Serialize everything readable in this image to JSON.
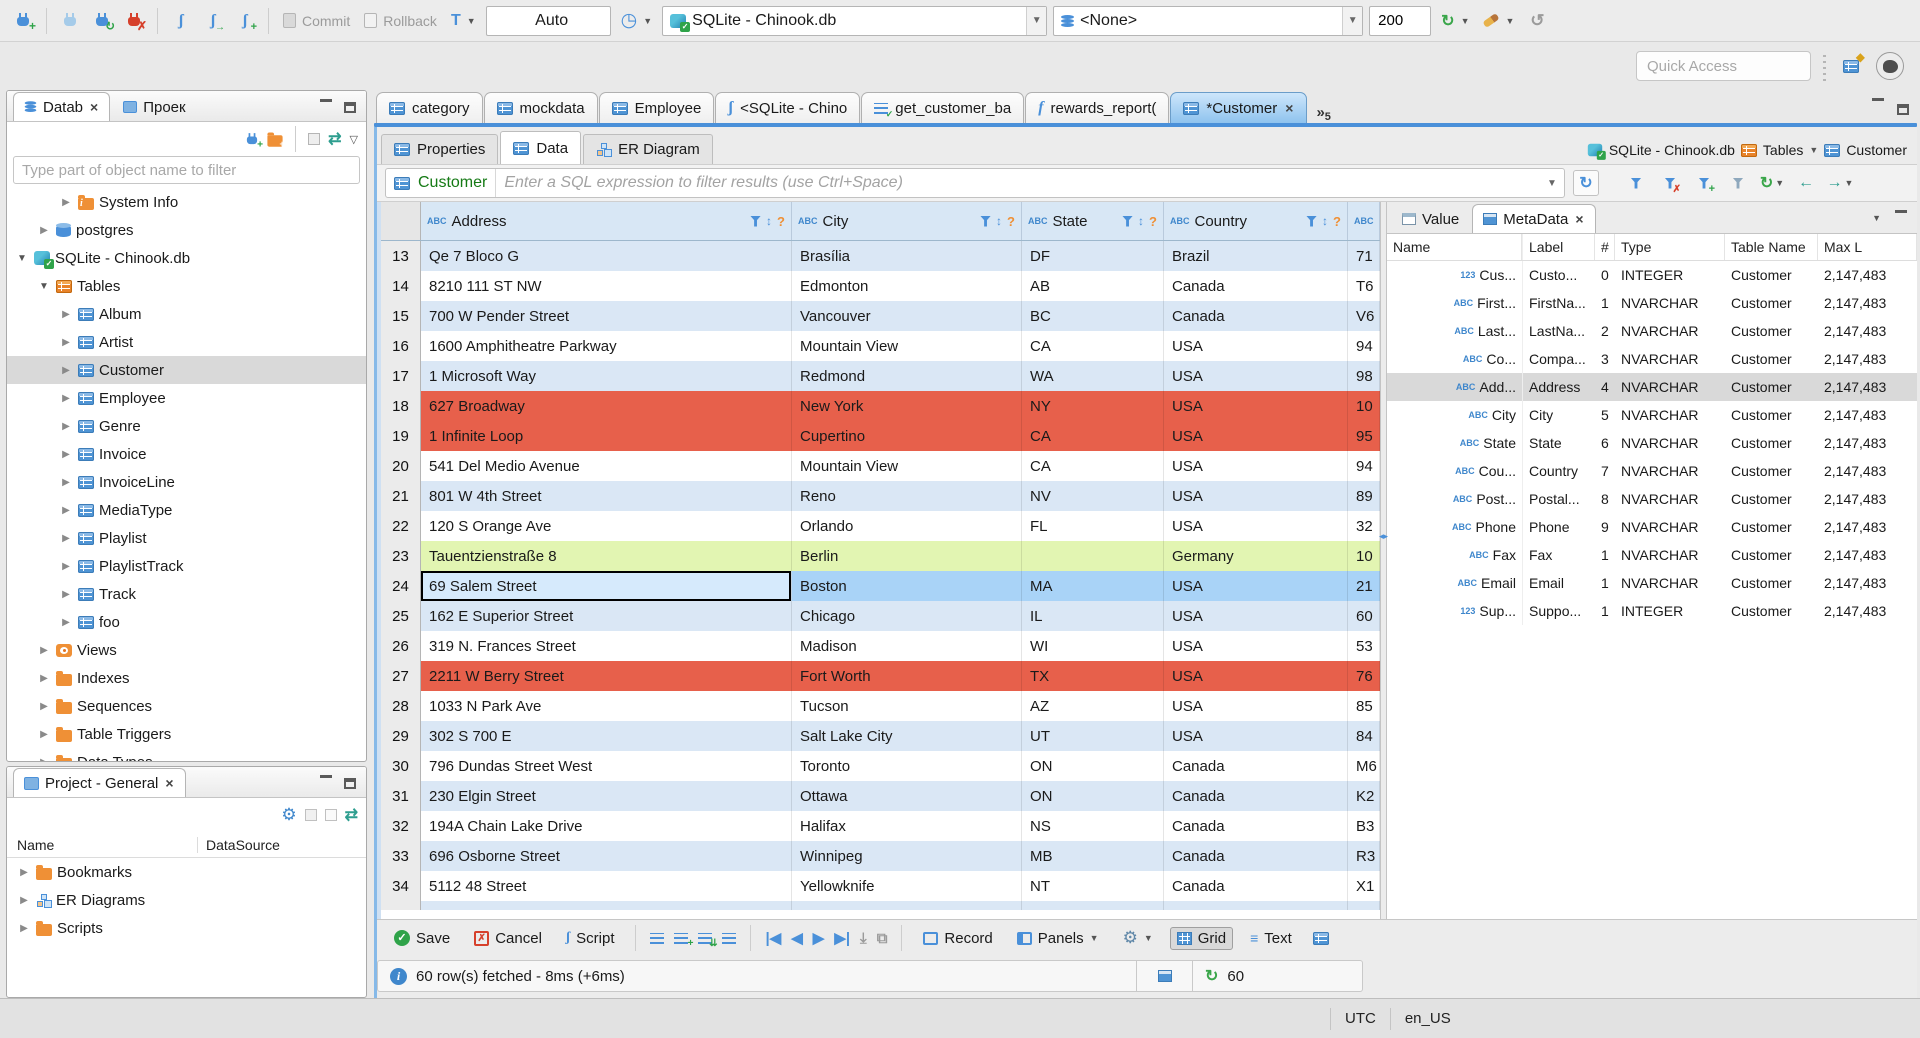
{
  "colors": {
    "accent": "#4a90d9",
    "row_alt": "#dae7f5",
    "row_red": "#e7604b",
    "row_green": "#e2f5b2",
    "row_selected": "#a9d3f7",
    "header_bg": "#d8e7f5",
    "table_green": "#157a15"
  },
  "toolbar": {
    "commit": "Commit",
    "rollback": "Rollback",
    "auto": "Auto",
    "connection": "SQLite - Chinook.db",
    "schema": "<None>",
    "fetch_size": "200",
    "quick_access": "Quick Access"
  },
  "navigator": {
    "tab_databases": "Datab",
    "tab_projects": "Проек",
    "filter_placeholder": "Type part of object name to filter",
    "tree": [
      {
        "label": "System Info",
        "icon": "folder-info",
        "indent": 2,
        "arrow": "right"
      },
      {
        "label": "postgres",
        "icon": "db",
        "indent": 1,
        "arrow": "right"
      },
      {
        "label": "SQLite - Chinook.db",
        "icon": "db-check",
        "indent": 0,
        "arrow": "down"
      },
      {
        "label": "Tables",
        "icon": "table-orange",
        "indent": 1,
        "arrow": "down"
      },
      {
        "label": "Album",
        "icon": "table",
        "indent": 2,
        "arrow": "right"
      },
      {
        "label": "Artist",
        "icon": "table",
        "indent": 2,
        "arrow": "right"
      },
      {
        "label": "Customer",
        "icon": "table",
        "indent": 2,
        "arrow": "right",
        "selected": true
      },
      {
        "label": "Employee",
        "icon": "table",
        "indent": 2,
        "arrow": "right"
      },
      {
        "label": "Genre",
        "icon": "table",
        "indent": 2,
        "arrow": "right"
      },
      {
        "label": "Invoice",
        "icon": "table",
        "indent": 2,
        "arrow": "right"
      },
      {
        "label": "InvoiceLine",
        "icon": "table",
        "indent": 2,
        "arrow": "right"
      },
      {
        "label": "MediaType",
        "icon": "table",
        "indent": 2,
        "arrow": "right"
      },
      {
        "label": "Playlist",
        "icon": "table",
        "indent": 2,
        "arrow": "right"
      },
      {
        "label": "PlaylistTrack",
        "icon": "table",
        "indent": 2,
        "arrow": "right"
      },
      {
        "label": "Track",
        "icon": "table",
        "indent": 2,
        "arrow": "right"
      },
      {
        "label": "foo",
        "icon": "table",
        "indent": 2,
        "arrow": "right"
      },
      {
        "label": "Views",
        "icon": "views",
        "indent": 1,
        "arrow": "right"
      },
      {
        "label": "Indexes",
        "icon": "folder",
        "indent": 1,
        "arrow": "right"
      },
      {
        "label": "Sequences",
        "icon": "folder",
        "indent": 1,
        "arrow": "right"
      },
      {
        "label": "Table Triggers",
        "icon": "folder",
        "indent": 1,
        "arrow": "right"
      },
      {
        "label": "Data Types",
        "icon": "folder",
        "indent": 1,
        "arrow": "right"
      }
    ]
  },
  "project_panel": {
    "title": "Project - General",
    "col_name": "Name",
    "col_datasource": "DataSource",
    "items": [
      {
        "label": "Bookmarks",
        "icon": "folder-bookmark"
      },
      {
        "label": "ER Diagrams",
        "icon": "er"
      },
      {
        "label": "Scripts",
        "icon": "folder"
      }
    ]
  },
  "editor": {
    "tabs": [
      {
        "label": "category",
        "icon": "table"
      },
      {
        "label": "mockdata",
        "icon": "table"
      },
      {
        "label": "Employee",
        "icon": "table"
      },
      {
        "label": "<SQLite - Chino",
        "icon": "sql"
      },
      {
        "label": "get_customer_ba",
        "icon": "proc"
      },
      {
        "label": "rewards_report(",
        "icon": "func"
      },
      {
        "label": "*Customer",
        "icon": "table",
        "active": true
      }
    ],
    "overflow_count": "5",
    "subtabs": [
      {
        "label": "Properties",
        "icon": "table"
      },
      {
        "label": "Data",
        "icon": "table",
        "active": true
      },
      {
        "label": "ER Diagram",
        "icon": "er"
      }
    ],
    "breadcrumb": [
      {
        "label": "SQLite - Chinook.db",
        "icon": "db-check"
      },
      {
        "label": "Tables",
        "icon": "table-orange",
        "dropdown": true
      },
      {
        "label": "Customer",
        "icon": "table"
      }
    ],
    "filter": {
      "table": "Customer",
      "placeholder": "Enter a SQL expression to filter results (use Ctrl+Space)"
    },
    "grid": {
      "columns": [
        "Address",
        "City",
        "State",
        "Country",
        ""
      ],
      "rows": [
        {
          "n": "13",
          "address": "Qe 7 Bloco G",
          "city": "Brasília",
          "state": "DF",
          "country": "Brazil",
          "extra": "71",
          "variant": "alt"
        },
        {
          "n": "14",
          "address": "8210 111 ST NW",
          "city": "Edmonton",
          "state": "AB",
          "country": "Canada",
          "extra": "T6",
          "variant": "plain"
        },
        {
          "n": "15",
          "address": "700 W Pender Street",
          "city": "Vancouver",
          "state": "BC",
          "country": "Canada",
          "extra": "V6",
          "variant": "alt"
        },
        {
          "n": "16",
          "address": "1600 Amphitheatre Parkway",
          "city": "Mountain View",
          "state": "CA",
          "country": "USA",
          "extra": "94",
          "variant": "plain"
        },
        {
          "n": "17",
          "address": "1 Microsoft Way",
          "city": "Redmond",
          "state": "WA",
          "country": "USA",
          "extra": "98",
          "variant": "alt"
        },
        {
          "n": "18",
          "address": "627 Broadway",
          "city": "New York",
          "state": "NY",
          "country": "USA",
          "extra": "10",
          "variant": "red"
        },
        {
          "n": "19",
          "address": "1 Infinite Loop",
          "city": "Cupertino",
          "state": "CA",
          "country": "USA",
          "extra": "95",
          "variant": "red"
        },
        {
          "n": "20",
          "address": "541 Del Medio Avenue",
          "city": "Mountain View",
          "state": "CA",
          "country": "USA",
          "extra": "94",
          "variant": "plain"
        },
        {
          "n": "21",
          "address": "801 W 4th Street",
          "city": "Reno",
          "state": "NV",
          "country": "USA",
          "extra": "89",
          "variant": "alt"
        },
        {
          "n": "22",
          "address": "120 S Orange Ave",
          "city": "Orlando",
          "state": "FL",
          "country": "USA",
          "extra": "32",
          "variant": "plain"
        },
        {
          "n": "23",
          "address": "Tauentzienstraße 8",
          "city": "Berlin",
          "state": "",
          "country": "Germany",
          "extra": "10",
          "variant": "green"
        },
        {
          "n": "24",
          "address": "69 Salem Street",
          "city": "Boston",
          "state": "MA",
          "country": "USA",
          "extra": "21",
          "variant": "selected"
        },
        {
          "n": "25",
          "address": "162 E Superior Street",
          "city": "Chicago",
          "state": "IL",
          "country": "USA",
          "extra": "60",
          "variant": "alt"
        },
        {
          "n": "26",
          "address": "319 N. Frances Street",
          "city": "Madison",
          "state": "WI",
          "country": "USA",
          "extra": "53",
          "variant": "plain"
        },
        {
          "n": "27",
          "address": "2211 W Berry Street",
          "city": "Fort Worth",
          "state": "TX",
          "country": "USA",
          "extra": "76",
          "variant": "red"
        },
        {
          "n": "28",
          "address": "1033 N Park Ave",
          "city": "Tucson",
          "state": "AZ",
          "country": "USA",
          "extra": "85",
          "variant": "plain"
        },
        {
          "n": "29",
          "address": "302 S 700 E",
          "city": "Salt Lake City",
          "state": "UT",
          "country": "USA",
          "extra": "84",
          "variant": "alt"
        },
        {
          "n": "30",
          "address": "796 Dundas Street West",
          "city": "Toronto",
          "state": "ON",
          "country": "Canada",
          "extra": "M6",
          "variant": "plain"
        },
        {
          "n": "31",
          "address": "230 Elgin Street",
          "city": "Ottawa",
          "state": "ON",
          "country": "Canada",
          "extra": "K2",
          "variant": "alt"
        },
        {
          "n": "32",
          "address": "194A Chain Lake Drive",
          "city": "Halifax",
          "state": "NS",
          "country": "Canada",
          "extra": "B3",
          "variant": "plain"
        },
        {
          "n": "33",
          "address": "696 Osborne Street",
          "city": "Winnipeg",
          "state": "MB",
          "country": "Canada",
          "extra": "R3",
          "variant": "alt"
        },
        {
          "n": "34",
          "address": "5112 48 Street",
          "city": "Yellowknife",
          "state": "NT",
          "country": "Canada",
          "extra": "X1",
          "variant": "plain"
        }
      ]
    },
    "meta": {
      "tab_value": "Value",
      "tab_meta": "MetaData",
      "columns": [
        "Name",
        "Label",
        "#",
        "Type",
        "Table Name",
        "Max L"
      ],
      "rows": [
        {
          "icon": "123",
          "name": "Cus...",
          "label": "Custo...",
          "num": "0",
          "type": "INTEGER",
          "table": "Customer",
          "max": "2,147,483"
        },
        {
          "icon": "abc",
          "name": "First...",
          "label": "FirstNa...",
          "num": "1",
          "type": "NVARCHAR",
          "table": "Customer",
          "max": "2,147,483"
        },
        {
          "icon": "abc",
          "name": "Last...",
          "label": "LastNa...",
          "num": "2",
          "type": "NVARCHAR",
          "table": "Customer",
          "max": "2,147,483"
        },
        {
          "icon": "abc",
          "name": "Co...",
          "label": "Compa...",
          "num": "3",
          "type": "NVARCHAR",
          "table": "Customer",
          "max": "2,147,483"
        },
        {
          "icon": "abc",
          "name": "Add...",
          "label": "Address",
          "num": "4",
          "type": "NVARCHAR",
          "table": "Customer",
          "max": "2,147,483",
          "selected": true
        },
        {
          "icon": "abc",
          "name": "City",
          "label": "City",
          "num": "5",
          "type": "NVARCHAR",
          "table": "Customer",
          "max": "2,147,483"
        },
        {
          "icon": "abc",
          "name": "State",
          "label": "State",
          "num": "6",
          "type": "NVARCHAR",
          "table": "Customer",
          "max": "2,147,483"
        },
        {
          "icon": "abc",
          "name": "Cou...",
          "label": "Country",
          "num": "7",
          "type": "NVARCHAR",
          "table": "Customer",
          "max": "2,147,483"
        },
        {
          "icon": "abc",
          "name": "Post...",
          "label": "Postal...",
          "num": "8",
          "type": "NVARCHAR",
          "table": "Customer",
          "max": "2,147,483"
        },
        {
          "icon": "abc",
          "name": "Phone",
          "label": "Phone",
          "num": "9",
          "type": "NVARCHAR",
          "table": "Customer",
          "max": "2,147,483"
        },
        {
          "icon": "abc",
          "name": "Fax",
          "label": "Fax",
          "num": "1",
          "type": "NVARCHAR",
          "table": "Customer",
          "max": "2,147,483"
        },
        {
          "icon": "abc",
          "name": "Email",
          "label": "Email",
          "num": "1",
          "type": "NVARCHAR",
          "table": "Customer",
          "max": "2,147,483"
        },
        {
          "icon": "123",
          "name": "Sup...",
          "label": "Suppo...",
          "num": "1",
          "type": "INTEGER",
          "table": "Customer",
          "max": "2,147,483"
        }
      ]
    },
    "btoolbar": {
      "save": "Save",
      "cancel": "Cancel",
      "script": "Script",
      "record": "Record",
      "panels": "Panels",
      "grid": "Grid",
      "text": "Text"
    },
    "status": {
      "fetch": "60 row(s) fetched - 8ms (+6ms)",
      "refresh_count": "60"
    }
  },
  "statusbar": {
    "timezone": "UTC",
    "locale": "en_US"
  }
}
